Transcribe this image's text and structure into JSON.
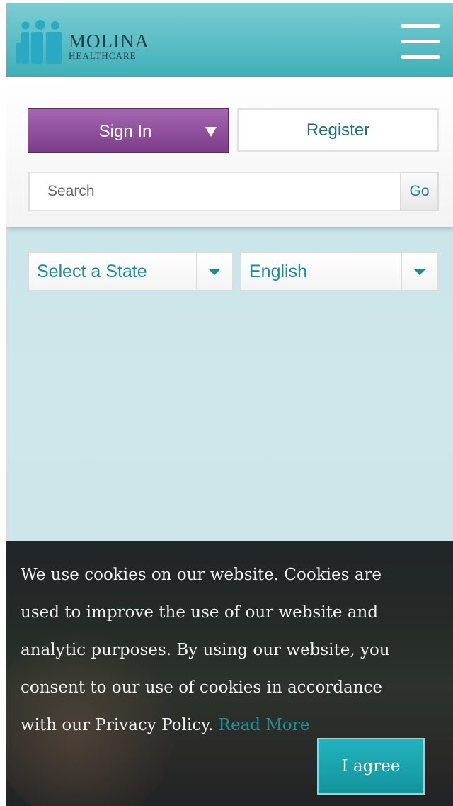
{
  "header": {
    "logo_line1": "MOLINA",
    "logo_line2": "HEALTHCARE",
    "menu_icon": "hamburger-menu-icon",
    "colors": {
      "header_top": "#7ccdd3",
      "header_bottom": "#3fb0b8",
      "logo_blue": "#2aa9c4"
    }
  },
  "auth": {
    "signin_label": "Sign In",
    "signin_caret_icon": "caret-down-icon",
    "register_label": "Register",
    "signin_color": "#8a4a98"
  },
  "search": {
    "placeholder": "Search",
    "value": "",
    "go_label": "Go"
  },
  "selectors": {
    "state": {
      "selected": "Select a State",
      "icon": "caret-down-icon"
    },
    "language": {
      "selected": "English",
      "icon": "caret-down-icon"
    },
    "accent": "#1d8a94"
  },
  "cookie_banner": {
    "text": "We use cookies on our website. Cookies are used to improve the use of our website and analytic purposes. By using our website, you consent to our use of cookies in accordance with our Privacy Policy.",
    "read_more_label": "Read More",
    "agree_label": "I agree",
    "agree_color": "#1aa3ac"
  }
}
